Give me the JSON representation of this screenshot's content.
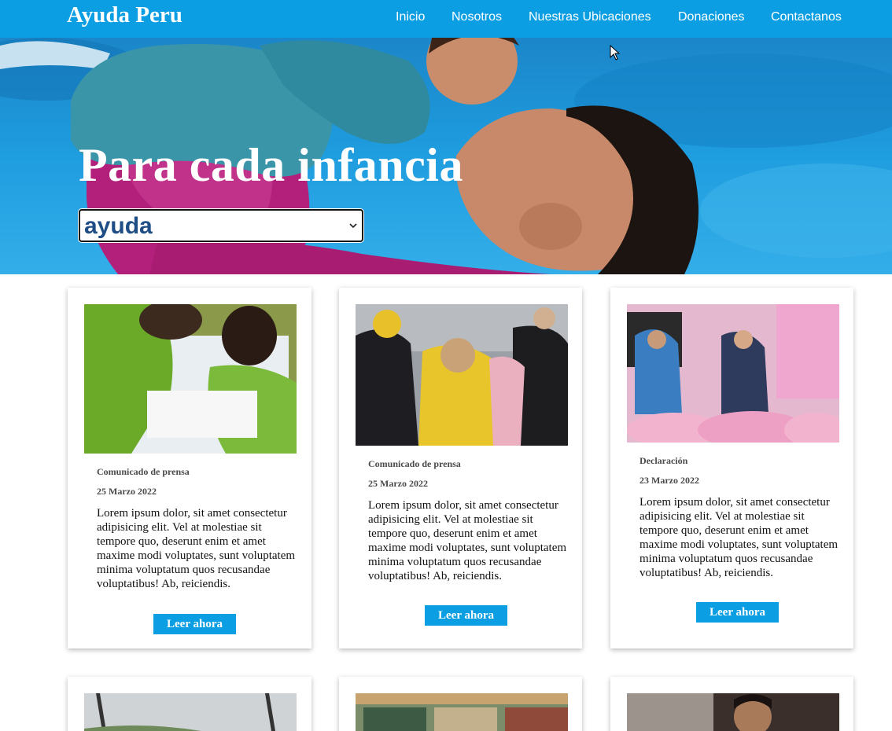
{
  "nav": {
    "brand": "Ayuda Peru",
    "links": [
      "Inicio",
      "Nosotros",
      "Nuestras Ubicaciones",
      "Donaciones",
      "Contactanos"
    ]
  },
  "hero": {
    "title": "Para cada infancia",
    "select_value": "ayuda"
  },
  "cards": [
    {
      "kind": "Comunicado de prensa",
      "date": "25 Marzo 2022",
      "text": "Lorem ipsum dolor, sit amet consectetur adipisicing elit. Vel at molestiae sit tempore quo, deserunt enim et amet maxime modi voluptates, sunt voluptatem minima voluptatum quos recusandae voluptatibus! Ab, reiciendis.",
      "button": "Leer ahora",
      "image": "children-studying-photo"
    },
    {
      "kind": "Comunicado de prensa",
      "date": "25 Marzo 2022",
      "text": "Lorem ipsum dolor, sit amet consectetur adipisicing elit. Vel at molestiae sit tempore quo, deserunt enim et amet maxime modi voluptates, sunt voluptatem minima voluptatum quos recusandae voluptatibus! Ab, reiciendis.",
      "button": "Leer ahora",
      "image": "refugee-family-photo"
    },
    {
      "kind": "Declaración",
      "date": "23 Marzo 2022",
      "text": "Lorem ipsum dolor, sit amet consectetur adipisicing elit. Vel at molestiae sit tempore quo, deserunt enim et amet maxime modi voluptates, sunt voluptatem minima voluptatum quos recusandae voluptatibus! Ab, reiciendis.",
      "button": "Leer ahora",
      "image": "classroom-girls-photo"
    }
  ],
  "colors": {
    "primary": "#0c9ee3",
    "select_text": "#1f4d86"
  }
}
